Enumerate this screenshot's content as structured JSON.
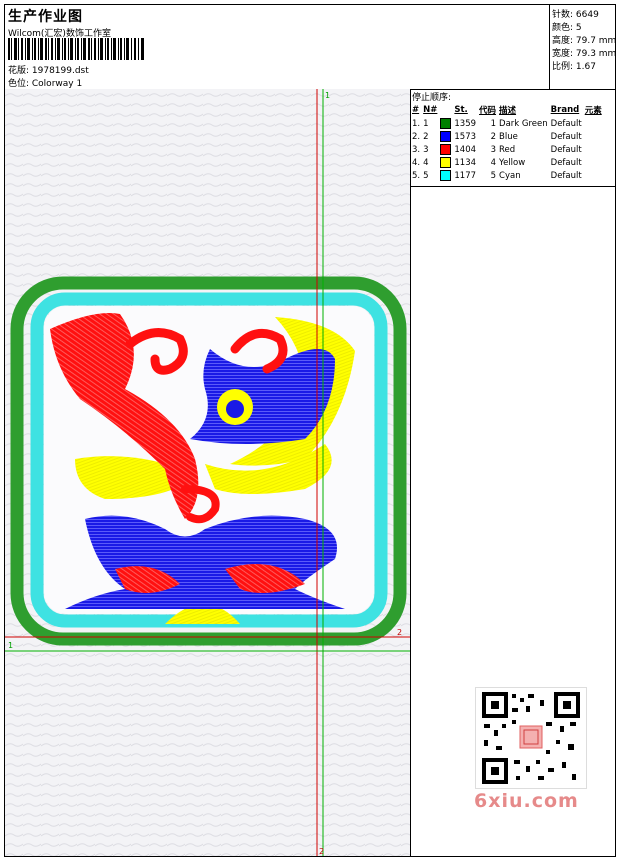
{
  "header": {
    "title": "生产作业图",
    "company": "Wilcom(汇宏)数饰工作室",
    "design_label": "花版: 1978199.dst",
    "colorway_label": "色位: Colorway 1"
  },
  "stats": {
    "stitches": "针数: 6649",
    "colors": "颜色: 5",
    "height": "高度: 79.7 mm",
    "width": "宽度: 79.3 mm",
    "scale": "比例: 1.67"
  },
  "stop_sequence": {
    "title": "停止顺序:",
    "headers": [
      "#",
      "N#",
      "St.",
      "代码",
      "描述",
      "Brand",
      "元素"
    ],
    "rows": [
      {
        "num": "1.",
        "n": "1",
        "color": "#008000",
        "stitches": "1359",
        "code": "1",
        "desc": "Dark Green",
        "brand": "Default"
      },
      {
        "num": "2.",
        "n": "2",
        "color": "#0000ff",
        "stitches": "1573",
        "code": "2",
        "desc": "Blue",
        "brand": "Default"
      },
      {
        "num": "3.",
        "n": "3",
        "color": "#ff0000",
        "stitches": "1404",
        "code": "3",
        "desc": "Red",
        "brand": "Default"
      },
      {
        "num": "4.",
        "n": "4",
        "color": "#ffff00",
        "stitches": "1134",
        "code": "4",
        "desc": "Yellow",
        "brand": "Default"
      },
      {
        "num": "5.",
        "n": "5",
        "color": "#00ffff",
        "stitches": "1177",
        "code": "5",
        "desc": "Cyan",
        "brand": "Default"
      }
    ]
  },
  "canvas": {
    "guide_v_top": "1",
    "guide_v_bottom": "2",
    "guide_h_left": "1",
    "guide_h_right": "2"
  },
  "watermark": "6xiu.com"
}
